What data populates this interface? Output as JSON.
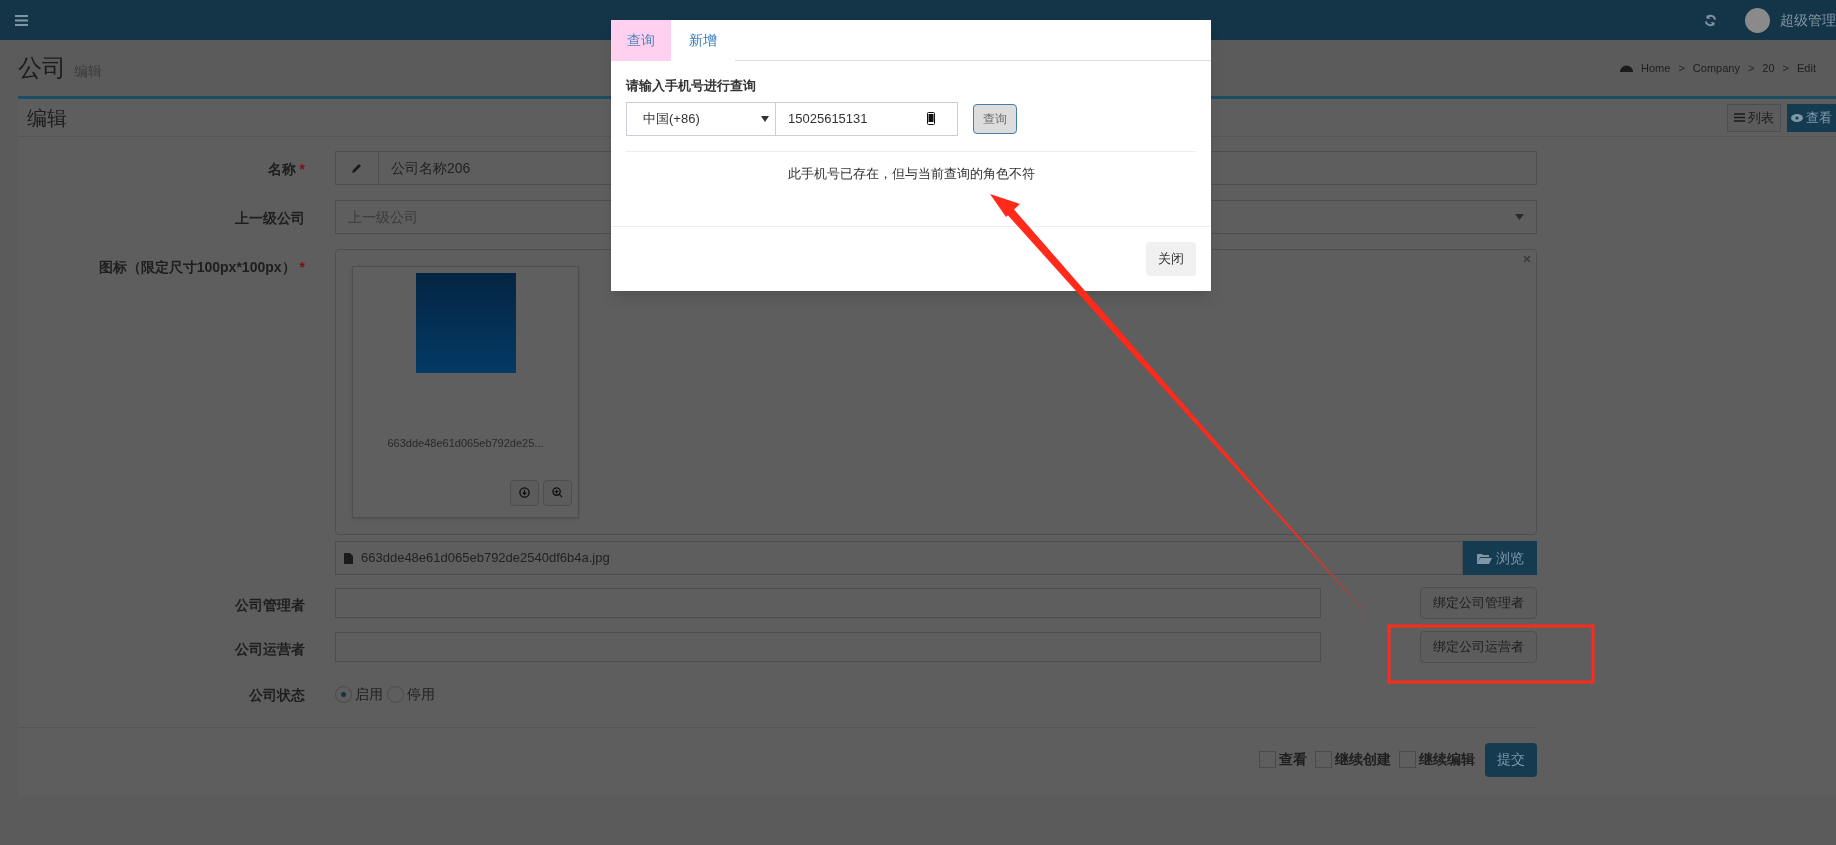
{
  "top_bar": {
    "user_name": "超级管理"
  },
  "page_header": {
    "title": "公司",
    "subtitle": "编辑"
  },
  "breadcrumb": [
    {
      "label": "Home"
    },
    {
      "separator": ">",
      "label": "Company"
    },
    {
      "separator": ">",
      "label": "20"
    },
    {
      "separator": ">",
      "label": "Edit"
    }
  ],
  "box": {
    "title": "编辑",
    "tools": [
      {
        "label": "列表",
        "kind": "list"
      },
      {
        "label": "查看",
        "kind": "view"
      }
    ]
  },
  "form": {
    "fields": [
      {
        "kind": "text",
        "label": "名称",
        "required_mark": "*",
        "value": "公司名称206"
      },
      {
        "kind": "select",
        "label": "上一级公司",
        "placeholder": "上一级公司"
      },
      {
        "kind": "image",
        "label": "图标（限定尺寸100px*100px）",
        "required_mark": "*",
        "caption": "663dde48e61d065eb792de25...",
        "file_name": "663dde48e61d065eb792de2540df6b4a.jpg",
        "browse": "浏览"
      },
      {
        "kind": "bind",
        "label": "公司管理者",
        "button": "绑定公司管理者"
      },
      {
        "kind": "bind",
        "label": "公司运营者",
        "button": "绑定公司运营者"
      },
      {
        "kind": "radio",
        "label": "公司状态",
        "options": [
          {
            "label": "启用",
            "selected": true
          },
          {
            "label": "停用",
            "selected": false
          }
        ]
      }
    ],
    "footer": {
      "checks": [
        {
          "label": "查看",
          "checked": false
        },
        {
          "label": "继续创建",
          "checked": false
        },
        {
          "label": "继续编辑",
          "checked": false
        }
      ],
      "submit": "提交"
    }
  },
  "modal": {
    "tabs": [
      {
        "label": "查询",
        "selected": true
      },
      {
        "label": "新增",
        "selected": false
      }
    ],
    "prompt": "请输入手机号进行查询",
    "country": "中国(+86)",
    "phone": "15025615131",
    "query_button": {
      "label": "查询",
      "disabled": true
    },
    "message": "此手机号已存在，但与当前查询的角色不符",
    "close": "关闭"
  }
}
